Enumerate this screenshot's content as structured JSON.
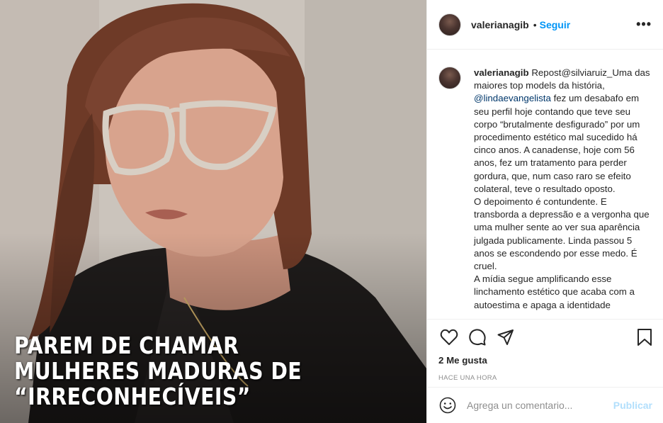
{
  "post": {
    "overlay_lines": [
      "Parem de chamar",
      "mulheres maduras de",
      "“Irreconhecíveis”"
    ]
  },
  "header": {
    "username": "valerianagib",
    "dot": "•",
    "follow_label": "Seguir",
    "more_label": "•••"
  },
  "caption": {
    "username": "valerianagib",
    "text_1": "Repost@silviaruiz_Uma das maiores top models da história,",
    "mention": "@lindaevangelista",
    "text_2": "fez um desabafo em seu perfil hoje contando que teve seu corpo “brutalmente desfigurado” por um procedimento estético mal sucedido há cinco anos.  A canadense, hoje com 56 anos, fez um tratamento para perder gordura, que, num caso raro se efeito colateral, teve o resultado oposto.",
    "paragraph_2": "O depoimento é contundente. E transborda a depressão e a vergonha que uma mulher sente ao ver sua aparência julgada publicamente. Linda passou 5 anos se escondendo por esse medo. É cruel.",
    "paragraph_3": "A mídia segue amplificando esse linchamento estético que acaba com a autoestima e apaga a identidade"
  },
  "actions": {
    "likes": "2 Me gusta",
    "time": "Hace una hora"
  },
  "comment": {
    "placeholder": "Agrega un comentario...",
    "publish_label": "Publicar"
  },
  "icons": {
    "like": "heart-icon",
    "comment": "comment-icon",
    "share": "share-icon",
    "save": "bookmark-icon",
    "emoji": "emoji-icon"
  },
  "colors": {
    "accent": "#0095f6",
    "publish_disabled": "#b2dffc",
    "mention": "#00376b",
    "muted": "#8e8e8e"
  }
}
